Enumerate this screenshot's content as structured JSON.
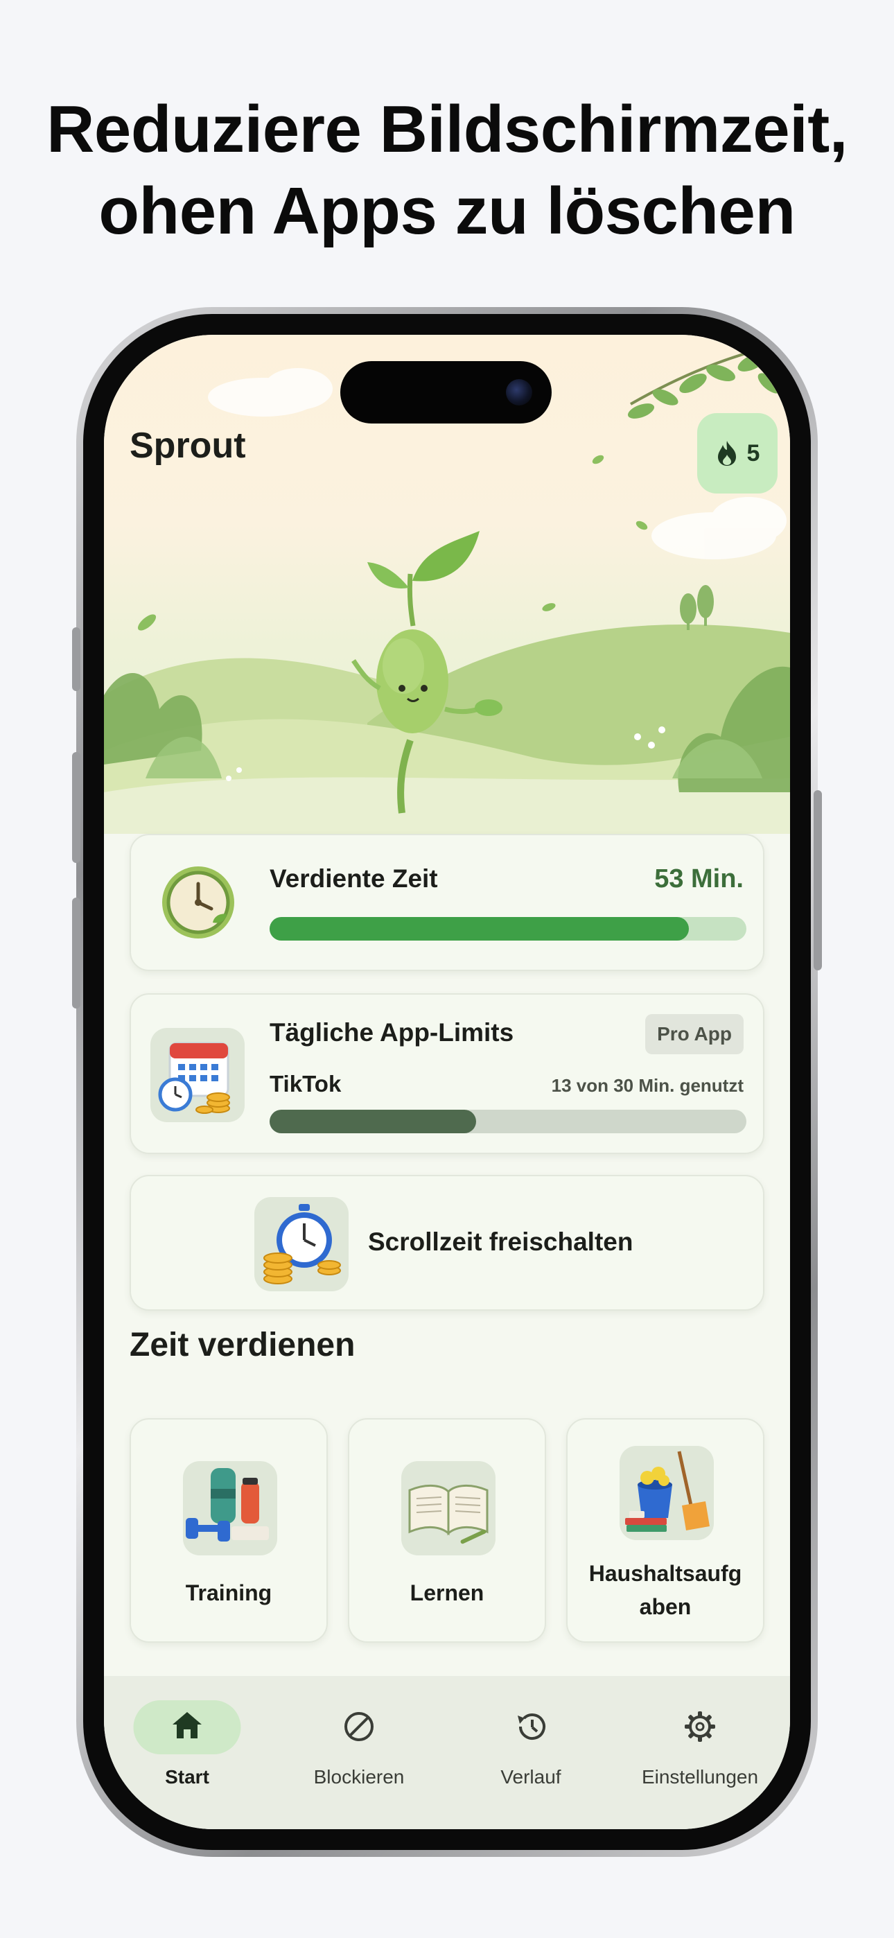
{
  "headline": {
    "line1": "Reduziere Bildschirmzeit,",
    "line2": "ohen Apps zu löschen"
  },
  "app": {
    "title": "Sprout",
    "streak_count": "5",
    "streak_icon": "flame-icon"
  },
  "earned_time": {
    "label": "Verdiente Zeit",
    "value": "53 Min.",
    "progress_fraction": 0.88,
    "icon": "clock-icon"
  },
  "app_limits": {
    "title": "Tägliche App-Limits",
    "badge": "Pro App",
    "app_name": "TikTok",
    "usage_text": "13 von 30 Min. genutzt",
    "used_minutes": 13,
    "limit_minutes": 30,
    "icon": "calendar-coins-icon"
  },
  "unlock": {
    "label": "Scrollzeit freischalten",
    "icon": "stopwatch-coins-icon"
  },
  "earn_section": {
    "title": "Zeit verdienen",
    "tiles": [
      {
        "label": "Training",
        "icon": "dumbbell-icon"
      },
      {
        "label": "Lernen",
        "icon": "book-icon"
      },
      {
        "label": "Haushaltsaufg aben",
        "icon": "cleaning-icon"
      }
    ]
  },
  "tabbar": {
    "tabs": [
      {
        "label": "Start",
        "icon": "home-icon",
        "active": true
      },
      {
        "label": "Blockieren",
        "icon": "block-icon",
        "active": false
      },
      {
        "label": "Verlauf",
        "icon": "history-icon",
        "active": false
      },
      {
        "label": "Einstellungen",
        "icon": "gear-icon",
        "active": false
      }
    ]
  },
  "colors": {
    "accent_green": "#3ea047",
    "limit_fill": "#4f6a4e",
    "streak_bg": "#c8ecc0",
    "screen_bg": "#f5f8f0"
  }
}
